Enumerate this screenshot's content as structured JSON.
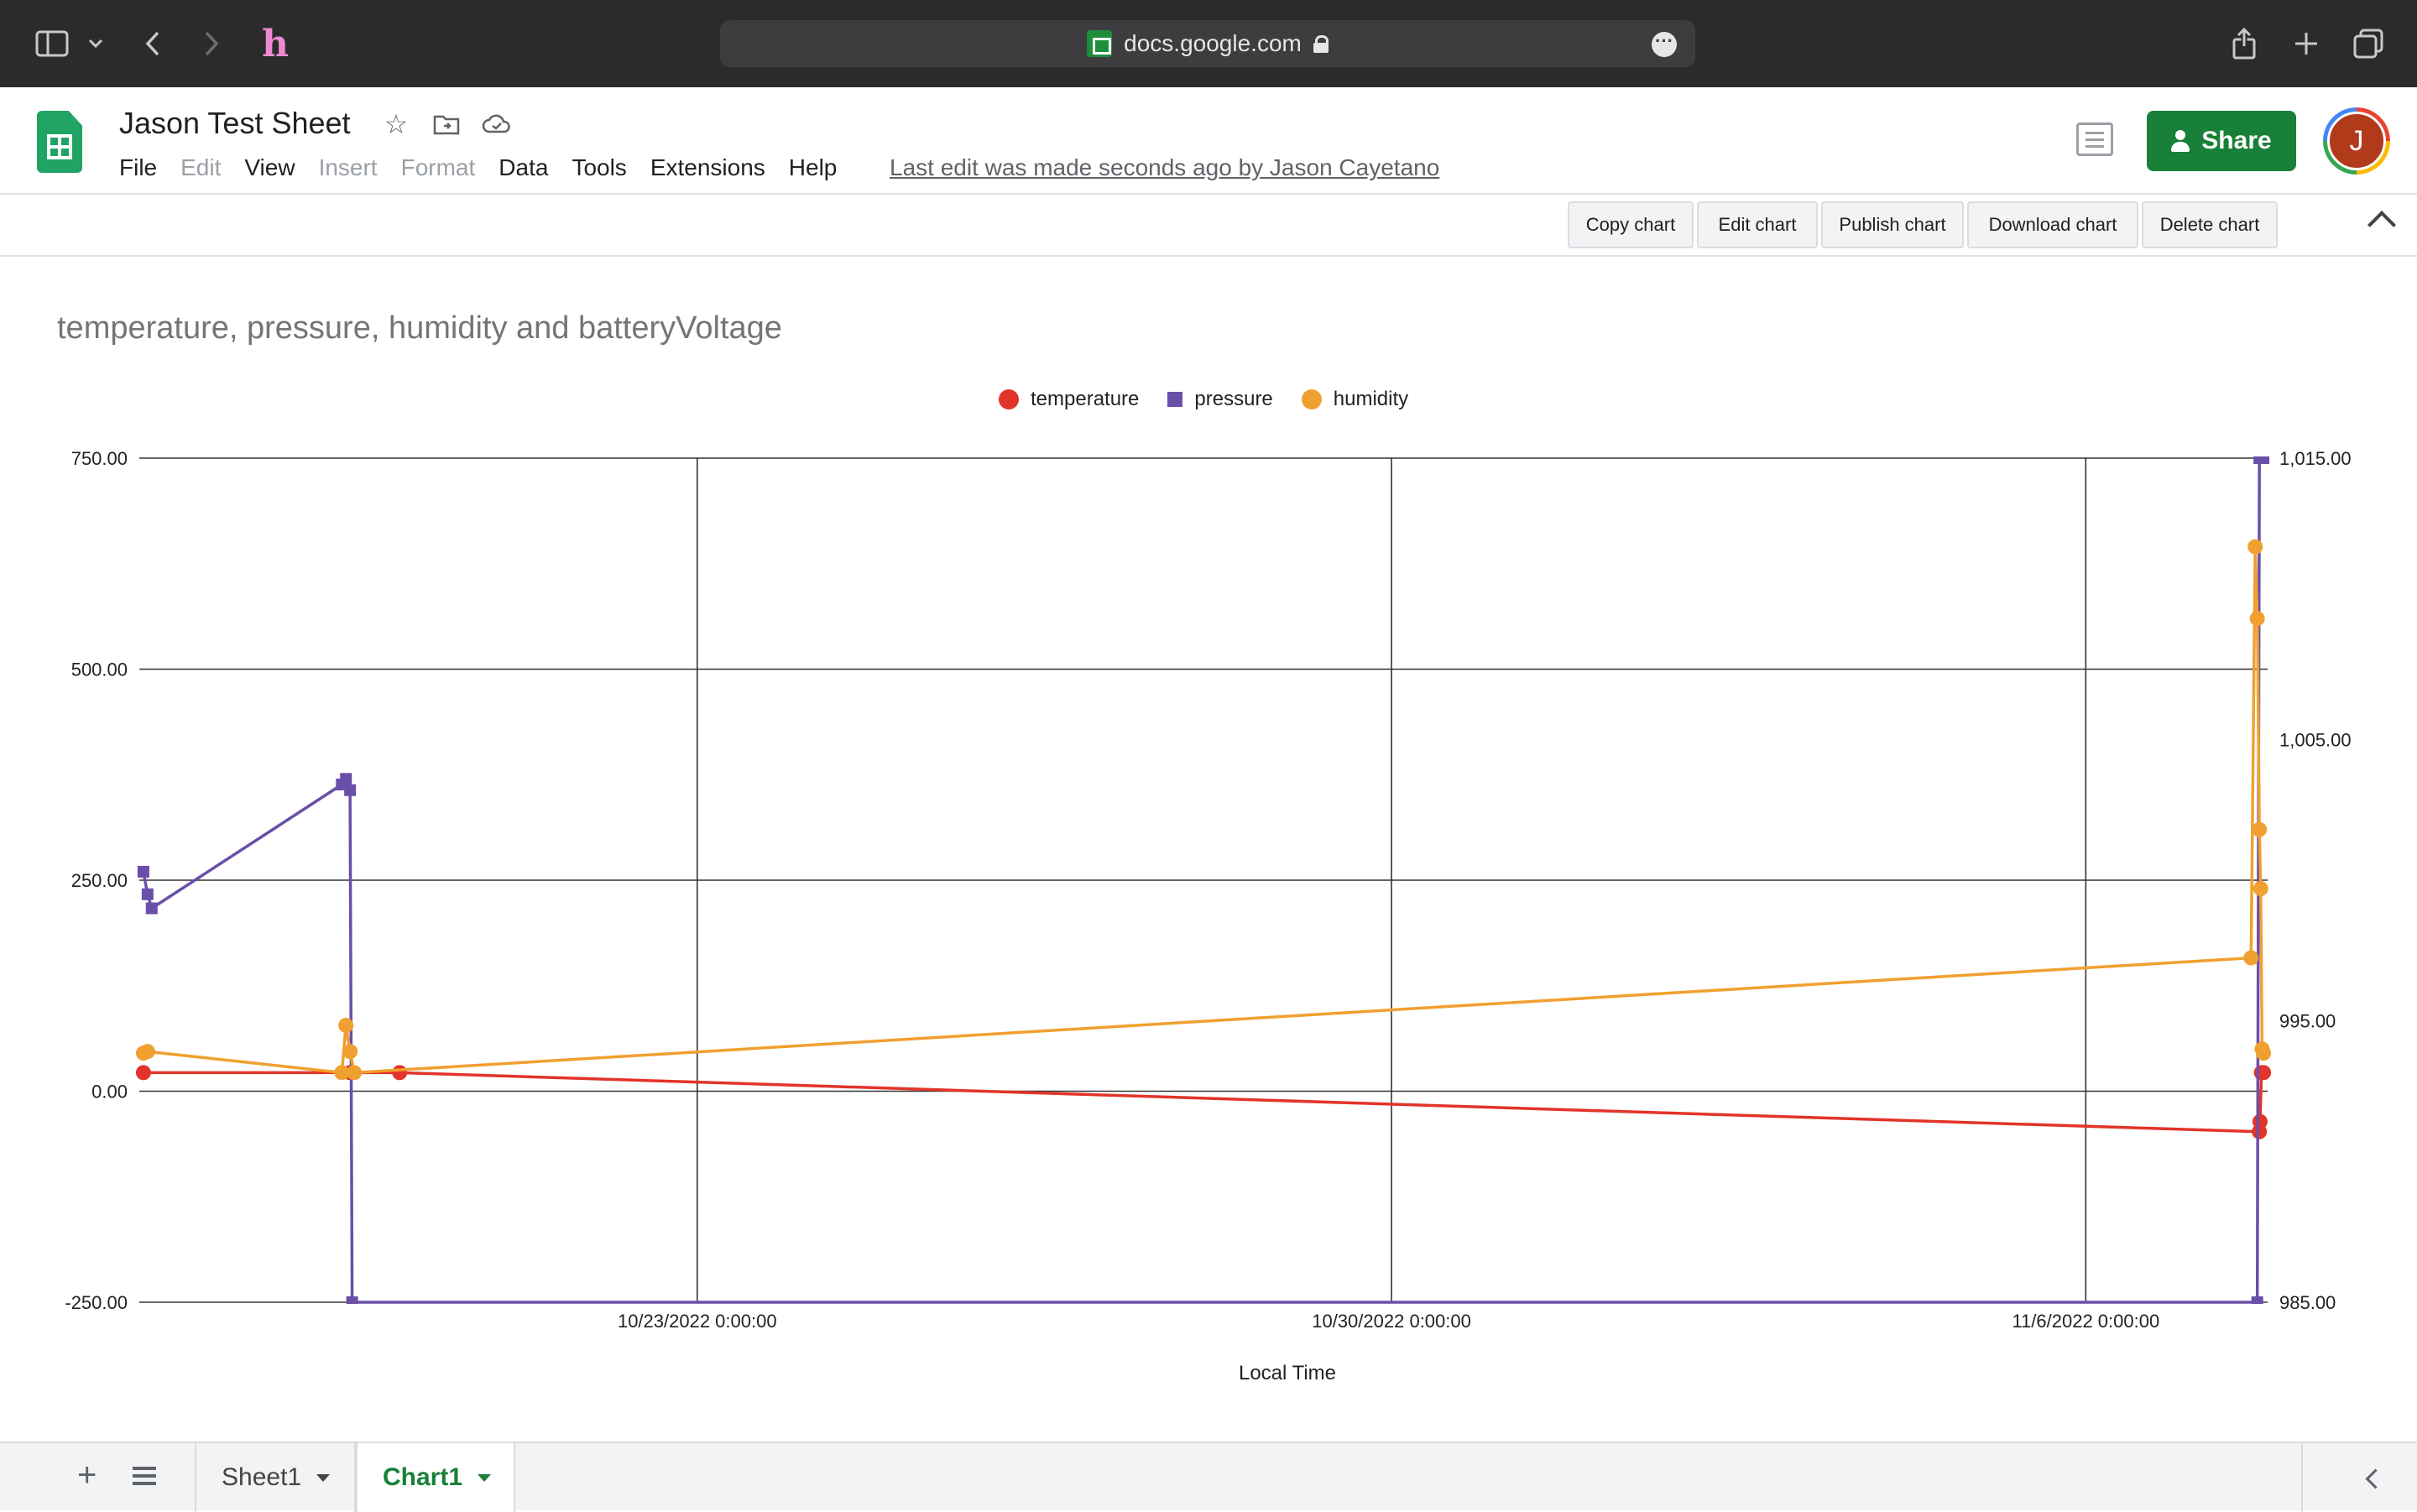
{
  "browser": {
    "url": "docs.google.com",
    "icons": [
      "sidebar-icon",
      "chevron-down-icon",
      "back-icon",
      "forward-icon",
      "honey-extension-icon",
      "share-icon",
      "new-tab-icon",
      "tabs-overview-icon"
    ]
  },
  "header": {
    "title": "Jason Test Sheet",
    "menu": [
      "File",
      "Edit",
      "View",
      "Insert",
      "Format",
      "Data",
      "Tools",
      "Extensions",
      "Help"
    ],
    "last_edit": "Last edit was made seconds ago by Jason Cayetano",
    "share_label": "Share",
    "avatar_initial": "J"
  },
  "chart_toolbar": {
    "buttons": [
      "Copy chart",
      "Edit chart",
      "Publish chart",
      "Download chart",
      "Delete chart"
    ]
  },
  "chart_data": {
    "type": "line",
    "title": "temperature, pressure, humidity and batteryVoltage",
    "xlabel": "Local Time",
    "ylabel": "",
    "x_ticks": [
      "10/23/2022 0:00:00",
      "10/30/2022 0:00:00",
      "11/6/2022 0:00:00"
    ],
    "xlim": [
      "10/17/2022 9:00",
      "11/7/2022 20:00"
    ],
    "y_left_ticks": [
      "750.00",
      "500.00",
      "250.00",
      "0.00",
      "-250.00"
    ],
    "ylim_left": [
      -250,
      750
    ],
    "y_right_ticks": [
      "1,015.00",
      "1,005.00",
      "995.00",
      "985.00"
    ],
    "ylim_right": [
      985,
      1015
    ],
    "grid": true,
    "legend_position": "top",
    "series": [
      {
        "name": "temperature",
        "color": "#e2342a",
        "marker": "circle",
        "axis": "left",
        "x": [
          "10/17/2022 10:00",
          "10/19/2022 12:00",
          "10/20/2022 0:00",
          "11/7/2022 18:00",
          "11/7/2022 18:10",
          "11/7/2022 18:30",
          "11/7/2022 19:00"
        ],
        "values": [
          22,
          22,
          22,
          -48,
          -36,
          22,
          22
        ]
      },
      {
        "name": "pressure",
        "color": "#6a4fa8",
        "marker": "square",
        "axis": "right",
        "x": [
          "10/17/2022 10:00",
          "10/17/2022 11:00",
          "10/17/2022 12:00",
          "10/19/2022 10:00",
          "10/19/2022 11:00",
          "10/19/2022 12:00",
          "10/19/2022 12:30",
          "11/7/2022 17:30",
          "11/7/2022 18:00",
          "11/7/2022 19:00"
        ],
        "values": [
          1000.3,
          999.5,
          999.0,
          1003.4,
          1003.6,
          1003.2,
          985,
          985,
          1015,
          1015
        ]
      },
      {
        "name": "humidity",
        "color": "#f0a030",
        "marker": "circle",
        "axis": "left",
        "x": [
          "10/17/2022 10:00",
          "10/17/2022 11:00",
          "10/19/2022 10:00",
          "10/19/2022 11:00",
          "10/19/2022 12:00",
          "10/19/2022 13:00",
          "11/7/2022 16:00",
          "11/7/2022 17:00",
          "11/7/2022 17:30",
          "11/7/2022 18:00",
          "11/7/2022 18:20",
          "11/7/2022 18:40",
          "11/7/2022 19:00"
        ],
        "values": [
          45,
          47,
          22,
          78,
          47,
          22,
          158,
          645,
          560,
          310,
          240,
          50,
          45
        ]
      }
    ]
  },
  "tabs": {
    "sheets": [
      "Sheet1",
      "Chart1"
    ],
    "active": "Chart1"
  }
}
